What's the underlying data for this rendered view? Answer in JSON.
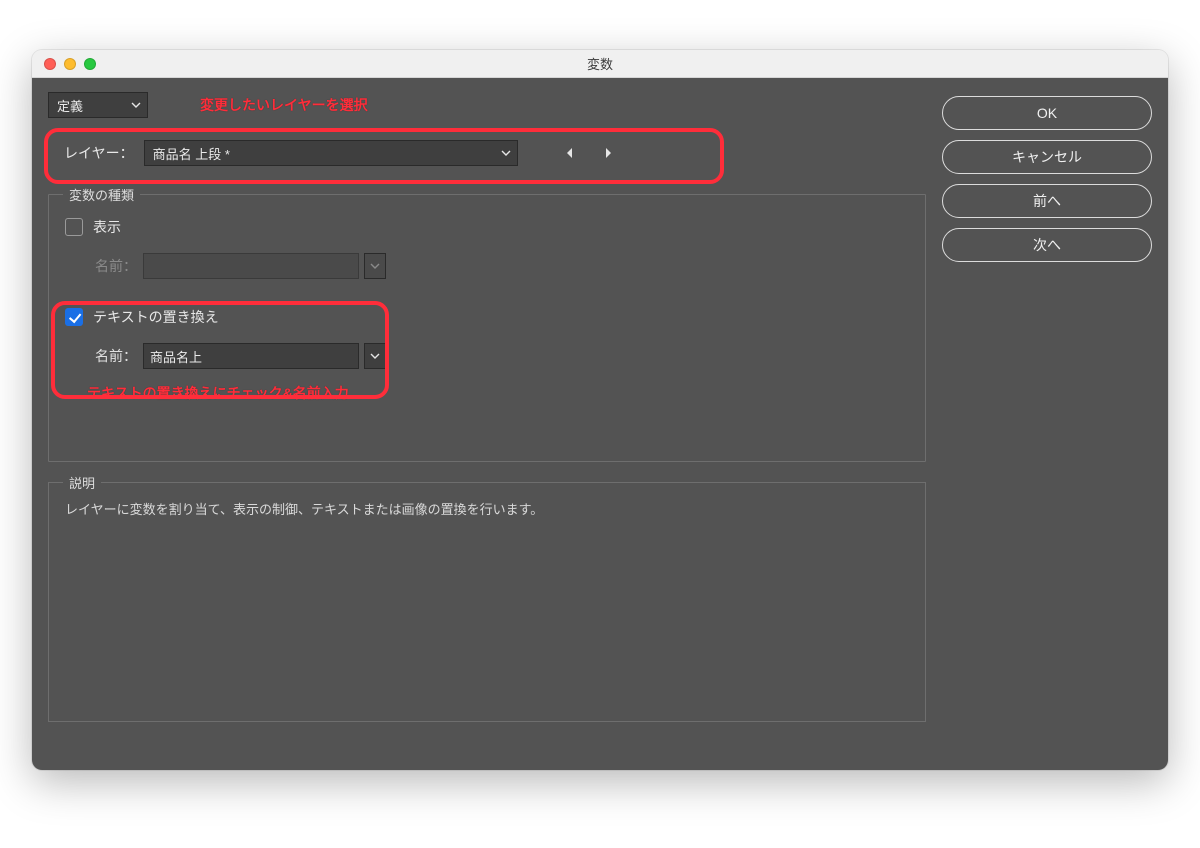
{
  "window": {
    "title": "変数"
  },
  "top": {
    "definition_label": "定義",
    "annotation_layer": "変更したいレイヤーを選択"
  },
  "layer": {
    "label": "レイヤー：",
    "value": "商品名 上段 *"
  },
  "variable_type": {
    "legend": "変数の種類",
    "display": {
      "label": "表示",
      "checked": false,
      "name_label": "名前：",
      "name_value": ""
    },
    "text_replace": {
      "label": "テキストの置き換え",
      "checked": true,
      "name_label": "名前：",
      "name_value": "商品名上"
    },
    "annotation_text_replace": "テキストの置き換えにチェック&名前入力"
  },
  "description": {
    "legend": "説明",
    "text": "レイヤーに変数を割り当て、表示の制御、テキストまたは画像の置換を行います。"
  },
  "buttons": {
    "ok": "OK",
    "cancel": "キャンセル",
    "prev": "前へ",
    "next": "次へ"
  }
}
